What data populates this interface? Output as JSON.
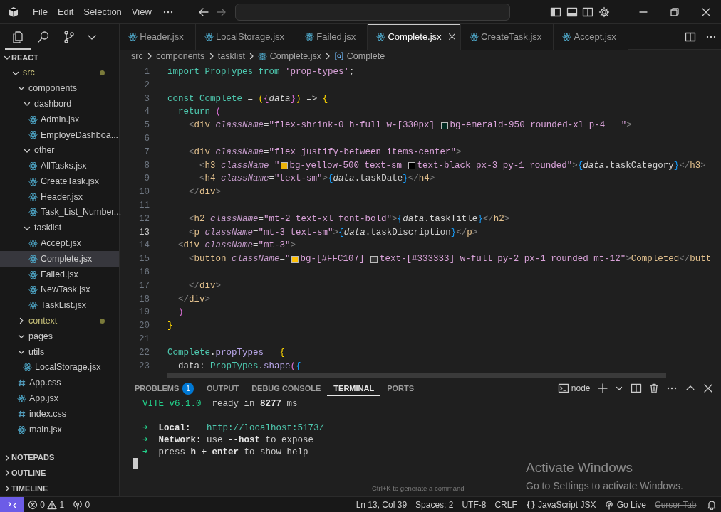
{
  "title_bar": {
    "menu": [
      "File",
      "Edit",
      "Selection",
      "View"
    ]
  },
  "activity_bar": [
    {
      "kind": "explorer",
      "selected": true
    },
    {
      "kind": "search",
      "selected": false
    },
    {
      "kind": "source-control",
      "selected": false
    }
  ],
  "explorer": {
    "title": "REACT",
    "tree": [
      {
        "label": "src",
        "kind": "folder",
        "expanded": true,
        "modified": true,
        "selected": false,
        "children": [
          {
            "label": "components",
            "kind": "folder",
            "expanded": true,
            "modified": false,
            "selected": false,
            "children": [
              {
                "label": "dashbord",
                "kind": "folder",
                "expanded": true,
                "modified": false,
                "selected": false,
                "children": [
                  {
                    "label": "Admin.jsx",
                    "kind": "react",
                    "modified": false,
                    "selected": false
                  },
                  {
                    "label": "EmployeDashboa...",
                    "kind": "react",
                    "modified": false,
                    "selected": false
                  }
                ]
              },
              {
                "label": "other",
                "kind": "folder",
                "expanded": true,
                "modified": false,
                "selected": false,
                "children": [
                  {
                    "label": "AllTasks.jsx",
                    "kind": "react",
                    "modified": false,
                    "selected": false
                  },
                  {
                    "label": "CreateTask.jsx",
                    "kind": "react",
                    "modified": false,
                    "selected": false
                  },
                  {
                    "label": "Header.jsx",
                    "kind": "react",
                    "modified": false,
                    "selected": false
                  },
                  {
                    "label": "Task_List_Number...",
                    "kind": "react",
                    "modified": false,
                    "selected": false
                  }
                ]
              },
              {
                "label": "tasklist",
                "kind": "folder",
                "expanded": true,
                "modified": false,
                "selected": false,
                "children": [
                  {
                    "label": "Accept.jsx",
                    "kind": "react",
                    "modified": false,
                    "selected": false
                  },
                  {
                    "label": "Complete.jsx",
                    "kind": "react",
                    "modified": false,
                    "selected": true
                  },
                  {
                    "label": "Failed.jsx",
                    "kind": "react",
                    "modified": false,
                    "selected": false
                  },
                  {
                    "label": "NewTask.jsx",
                    "kind": "react",
                    "modified": false,
                    "selected": false
                  },
                  {
                    "label": "TaskList.jsx",
                    "kind": "react",
                    "modified": false,
                    "selected": false
                  }
                ]
              }
            ]
          },
          {
            "label": "context",
            "kind": "folder",
            "expanded": false,
            "modified": true,
            "selected": false
          },
          {
            "label": "pages",
            "kind": "folder",
            "expanded": true,
            "modified": false,
            "selected": false
          },
          {
            "label": "utils",
            "kind": "folder",
            "expanded": true,
            "modified": false,
            "selected": false,
            "children": [
              {
                "label": "LocalStorage.jsx",
                "kind": "react",
                "modified": false,
                "selected": false
              }
            ]
          },
          {
            "label": "App.css",
            "kind": "css",
            "modified": false,
            "selected": false
          },
          {
            "label": "App.jsx",
            "kind": "react",
            "modified": false,
            "selected": false
          },
          {
            "label": "index.css",
            "kind": "css",
            "modified": false,
            "selected": false
          },
          {
            "label": "main.jsx",
            "kind": "react",
            "modified": false,
            "selected": false
          }
        ]
      }
    ],
    "sections": [
      "NOTEPADS",
      "OUTLINE",
      "TIMELINE"
    ]
  },
  "tabs": [
    {
      "label": "Header.jsx",
      "selected": false
    },
    {
      "label": "LocalStorage.jsx",
      "selected": false
    },
    {
      "label": "Failed.jsx",
      "selected": false
    },
    {
      "label": "Complete.jsx",
      "selected": true
    },
    {
      "label": "CreateTask.jsx",
      "selected": false
    },
    {
      "label": "Accept.jsx",
      "selected": false
    }
  ],
  "breadcrumb": [
    {
      "text": "src",
      "kind": "folder"
    },
    {
      "text": "components",
      "kind": "folder"
    },
    {
      "text": "tasklist",
      "kind": "folder"
    },
    {
      "text": "Complete.jsx",
      "kind": "file"
    },
    {
      "text": "Complete",
      "kind": "symbol"
    }
  ],
  "editor": {
    "lines": [
      {
        "number": "1",
        "current": false,
        "tokens": [
          {
            "kind": "kw",
            "text": "import "
          },
          {
            "kind": "name",
            "text": "PropTypes "
          },
          {
            "kind": "kw",
            "text": "from "
          },
          {
            "kind": "str",
            "text": "'prop-types'"
          },
          {
            "kind": "punct",
            "text": ";"
          }
        ]
      },
      {
        "number": "2",
        "current": false
      },
      {
        "number": "3",
        "current": false,
        "tokens": [
          {
            "kind": "kw",
            "text": "const "
          },
          {
            "kind": "name",
            "text": "Complete "
          },
          {
            "kind": "punct",
            "text": "= "
          },
          {
            "kind": "b1",
            "text": "("
          },
          {
            "kind": "b2",
            "text": "{"
          },
          {
            "kind": "param",
            "text": "data"
          },
          {
            "kind": "b2",
            "text": "}"
          },
          {
            "kind": "b1",
            "text": ")"
          },
          {
            "kind": "punct",
            "text": " => "
          },
          {
            "kind": "b1",
            "text": "{"
          }
        ]
      },
      {
        "number": "4",
        "current": false,
        "tokens": [
          {
            "kind": "kw",
            "text": "  return "
          },
          {
            "kind": "b2",
            "text": "("
          }
        ]
      },
      {
        "number": "5",
        "current": false,
        "tokens": [
          {
            "kind": "angle",
            "text": "    <"
          },
          {
            "kind": "tag",
            "text": "div "
          },
          {
            "kind": "attr",
            "text": "className"
          },
          {
            "kind": "punct",
            "text": "="
          },
          {
            "kind": "str",
            "text": "\"flex-shrink-0 h-full w-[330px] "
          },
          {
            "kind": "swatch",
            "color": "#022c22"
          },
          {
            "kind": "str",
            "text": "bg-emerald-950 rounded-xl p-4   \""
          },
          {
            "kind": "angle",
            "text": ">"
          }
        ]
      },
      {
        "number": "6",
        "current": false
      },
      {
        "number": "7",
        "current": false,
        "tokens": [
          {
            "kind": "angle",
            "text": "    <"
          },
          {
            "kind": "tag",
            "text": "div "
          },
          {
            "kind": "attr",
            "text": "className"
          },
          {
            "kind": "punct",
            "text": "="
          },
          {
            "kind": "str",
            "text": "\"flex justify-between items-center\""
          },
          {
            "kind": "angle",
            "text": ">"
          }
        ]
      },
      {
        "number": "8",
        "current": false,
        "tokens": [
          {
            "kind": "angle",
            "text": "      <"
          },
          {
            "kind": "tag",
            "text": "h3 "
          },
          {
            "kind": "attr",
            "text": "className"
          },
          {
            "kind": "punct",
            "text": "="
          },
          {
            "kind": "str",
            "text": "\""
          },
          {
            "kind": "swatch",
            "color": "#eab308"
          },
          {
            "kind": "str",
            "text": "bg-yellow-500 text-sm "
          },
          {
            "kind": "swatch",
            "color": "#000000"
          },
          {
            "kind": "str",
            "text": "text-black px-3 py-1 rounded\""
          },
          {
            "kind": "angle",
            "text": ">"
          },
          {
            "kind": "b3",
            "text": "{"
          },
          {
            "kind": "param",
            "text": "data"
          },
          {
            "kind": "punct",
            "text": ".taskCategory"
          },
          {
            "kind": "b3",
            "text": "}"
          },
          {
            "kind": "angle",
            "text": "</"
          },
          {
            "kind": "tag",
            "text": "h3"
          },
          {
            "kind": "angle",
            "text": ">"
          }
        ]
      },
      {
        "number": "9",
        "current": false,
        "tokens": [
          {
            "kind": "angle",
            "text": "      <"
          },
          {
            "kind": "tag",
            "text": "h4 "
          },
          {
            "kind": "attr",
            "text": "className"
          },
          {
            "kind": "punct",
            "text": "="
          },
          {
            "kind": "str",
            "text": "\"text-sm\""
          },
          {
            "kind": "angle",
            "text": ">"
          },
          {
            "kind": "b3",
            "text": "{"
          },
          {
            "kind": "param",
            "text": "data"
          },
          {
            "kind": "punct",
            "text": ".taskDate"
          },
          {
            "kind": "b3",
            "text": "}"
          },
          {
            "kind": "angle",
            "text": "</"
          },
          {
            "kind": "tag",
            "text": "h4"
          },
          {
            "kind": "angle",
            "text": ">"
          }
        ]
      },
      {
        "number": "10",
        "current": false,
        "tokens": [
          {
            "kind": "angle",
            "text": "    </"
          },
          {
            "kind": "tag",
            "text": "div"
          },
          {
            "kind": "angle",
            "text": ">"
          }
        ]
      },
      {
        "number": "11",
        "current": false
      },
      {
        "number": "12",
        "current": false,
        "tokens": [
          {
            "kind": "angle",
            "text": "    <"
          },
          {
            "kind": "tag",
            "text": "h2 "
          },
          {
            "kind": "attr",
            "text": "className"
          },
          {
            "kind": "punct",
            "text": "="
          },
          {
            "kind": "str",
            "text": "\"mt-2 text-xl font-bold\""
          },
          {
            "kind": "angle",
            "text": ">"
          },
          {
            "kind": "b3",
            "text": "{"
          },
          {
            "kind": "param",
            "text": "data"
          },
          {
            "kind": "punct",
            "text": ".taskTitle"
          },
          {
            "kind": "b3",
            "text": "}"
          },
          {
            "kind": "angle",
            "text": "</"
          },
          {
            "kind": "tag",
            "text": "h2"
          },
          {
            "kind": "angle",
            "text": ">"
          }
        ]
      },
      {
        "number": "13",
        "current": true,
        "tokens": [
          {
            "kind": "angle",
            "text": "    <"
          },
          {
            "kind": "tag",
            "text": "p "
          },
          {
            "kind": "attr",
            "text": "className"
          },
          {
            "kind": "punct",
            "text": "="
          },
          {
            "kind": "str",
            "text": "\"mt-3 text-sm\""
          },
          {
            "kind": "angle",
            "text": ">"
          },
          {
            "kind": "b3",
            "text": "{"
          },
          {
            "kind": "param",
            "text": "data"
          },
          {
            "kind": "punct",
            "text": ".taskDiscription"
          },
          {
            "kind": "b3",
            "text": "}"
          },
          {
            "kind": "angle",
            "text": "</"
          },
          {
            "kind": "tag",
            "text": "p"
          },
          {
            "kind": "angle",
            "text": ">"
          }
        ]
      },
      {
        "number": "14",
        "current": false,
        "tokens": [
          {
            "kind": "angle",
            "text": "  <"
          },
          {
            "kind": "tag",
            "text": "div "
          },
          {
            "kind": "attr",
            "text": "className"
          },
          {
            "kind": "punct",
            "text": "="
          },
          {
            "kind": "str",
            "text": "\"mt-3\""
          },
          {
            "kind": "angle",
            "text": ">"
          }
        ]
      },
      {
        "number": "15",
        "current": false,
        "tokens": [
          {
            "kind": "angle",
            "text": "    <"
          },
          {
            "kind": "tag",
            "text": "button "
          },
          {
            "kind": "attr",
            "text": "className"
          },
          {
            "kind": "punct",
            "text": "="
          },
          {
            "kind": "str",
            "text": "\""
          },
          {
            "kind": "swatch",
            "color": "#ffc107"
          },
          {
            "kind": "str",
            "text": "bg-[#FFC107] "
          },
          {
            "kind": "swatch",
            "color": "#333333"
          },
          {
            "kind": "str",
            "text": "text-[#333333] w-full py-2 px-1 rounded mt-12\""
          },
          {
            "kind": "angle",
            "text": ">"
          },
          {
            "kind": "tag",
            "text": "Completed"
          },
          {
            "kind": "angle",
            "text": "</"
          },
          {
            "kind": "tag",
            "text": "butt"
          }
        ]
      },
      {
        "number": "16",
        "current": false
      },
      {
        "number": "17",
        "current": false,
        "tokens": [
          {
            "kind": "angle",
            "text": "    </"
          },
          {
            "kind": "tag",
            "text": "div"
          },
          {
            "kind": "angle",
            "text": ">"
          }
        ]
      },
      {
        "number": "18",
        "current": false,
        "tokens": [
          {
            "kind": "angle",
            "text": "  </"
          },
          {
            "kind": "tag",
            "text": "div"
          },
          {
            "kind": "angle",
            "text": ">"
          }
        ]
      },
      {
        "number": "19",
        "current": false,
        "tokens": [
          {
            "kind": "b2",
            "text": "  )"
          }
        ]
      },
      {
        "number": "20",
        "current": false,
        "tokens": [
          {
            "kind": "b1",
            "text": "}"
          }
        ]
      },
      {
        "number": "21",
        "current": false
      },
      {
        "number": "22",
        "current": false,
        "tokens": [
          {
            "kind": "name",
            "text": "Complete"
          },
          {
            "kind": "punct",
            "text": "."
          },
          {
            "kind": "fn",
            "text": "propTypes"
          },
          {
            "kind": "punct",
            "text": " = "
          },
          {
            "kind": "b1",
            "text": "{"
          }
        ]
      },
      {
        "number": "23",
        "current": false,
        "tokens": [
          {
            "kind": "prop",
            "text": "  data"
          },
          {
            "kind": "punct",
            "text": ": "
          },
          {
            "kind": "name",
            "text": "PropTypes"
          },
          {
            "kind": "punct",
            "text": "."
          },
          {
            "kind": "fn",
            "text": "shape"
          },
          {
            "kind": "b2",
            "text": "("
          },
          {
            "kind": "b3",
            "text": "{"
          }
        ]
      }
    ]
  },
  "panel": {
    "tabs": [
      {
        "label": "PROBLEMS",
        "badge": "1",
        "selected": false
      },
      {
        "label": "OUTPUT",
        "selected": false
      },
      {
        "label": "DEBUG CONSOLE",
        "selected": false
      },
      {
        "label": "TERMINAL",
        "selected": true
      },
      {
        "label": "PORTS",
        "selected": false
      }
    ],
    "terminal_name": "node",
    "lines": [
      {
        "kind": "output",
        "tokens": [
          {
            "kind": "green",
            "text": "VITE v6.1.0"
          },
          {
            "kind": "plain",
            "text": "  ready in "
          },
          {
            "kind": "bold",
            "text": "8277"
          },
          {
            "kind": "plain",
            "text": " ms"
          }
        ]
      },
      {
        "kind": "blank"
      },
      {
        "kind": "output",
        "tokens": [
          {
            "kind": "green",
            "text": "➜  "
          },
          {
            "kind": "bold",
            "text": "Local:   "
          },
          {
            "kind": "link",
            "text": "http://localhost:5173/"
          }
        ]
      },
      {
        "kind": "output",
        "tokens": [
          {
            "kind": "green",
            "text": "➜  "
          },
          {
            "kind": "bold",
            "text": "Network:"
          },
          {
            "kind": "plain",
            "text": " use "
          },
          {
            "kind": "bold",
            "text": "--host"
          },
          {
            "kind": "plain",
            "text": " to expose"
          }
        ]
      },
      {
        "kind": "output",
        "tokens": [
          {
            "kind": "green",
            "text": "➜  "
          },
          {
            "kind": "plain",
            "text": "press "
          },
          {
            "kind": "bold",
            "text": "h + enter"
          },
          {
            "kind": "plain",
            "text": " to show help"
          }
        ]
      }
    ],
    "hint": "Ctrl+K to generate a command"
  },
  "activation_notice": {
    "title": "Activate Windows",
    "text": "Go to Settings to activate Windows."
  },
  "status_bar": {
    "errors": "0",
    "warnings": "1",
    "ports": "0",
    "right": [
      {
        "text": "Ln 13, Col 39",
        "kind": "plain",
        "disabled": false
      },
      {
        "text": "Spaces: 2",
        "kind": "plain",
        "disabled": false
      },
      {
        "text": "UTF-8",
        "kind": "plain",
        "disabled": false
      },
      {
        "text": "CRLF",
        "kind": "plain",
        "disabled": false
      },
      {
        "text": "JavaScript JSX",
        "kind": "language",
        "disabled": false
      },
      {
        "text": "Go Live",
        "kind": "live",
        "disabled": false
      },
      {
        "text": "Cursor Tab",
        "kind": "plain",
        "disabled": true
      }
    ]
  }
}
